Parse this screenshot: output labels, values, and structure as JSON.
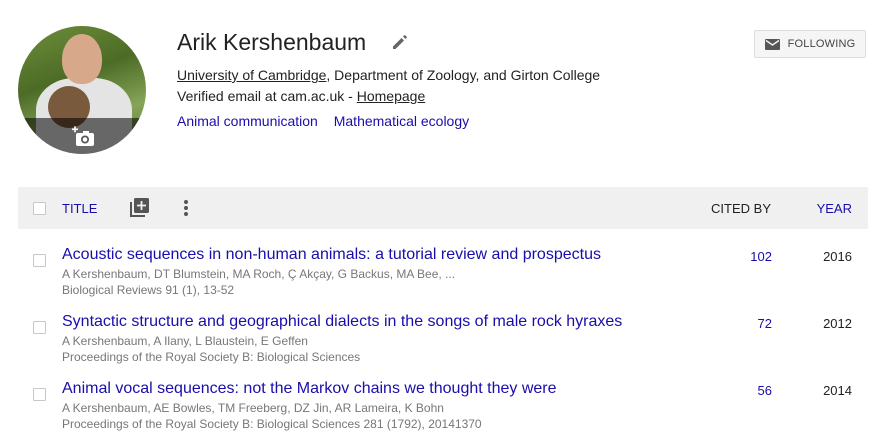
{
  "profile": {
    "name": "Arik Kershenbaum",
    "affiliation_link": "University of Cambridge",
    "affiliation_rest": ", Department of Zoology, and Girton College",
    "email_text": "Verified email at cam.ac.uk - ",
    "homepage_link": "Homepage",
    "interests": [
      "Animal communication",
      "Mathematical ecology"
    ],
    "follow_label": "FOLLOWING"
  },
  "table": {
    "title_label": "TITLE",
    "cited_label": "CITED BY",
    "year_label": "YEAR"
  },
  "articles": [
    {
      "title": "Acoustic sequences in non-human animals: a tutorial review and prospectus",
      "authors": "A Kershenbaum, DT Blumstein, MA Roch, Ç Akçay, G Backus, MA Bee, ...",
      "venue": "Biological Reviews 91 (1), 13-52",
      "cited": "102",
      "year": "2016"
    },
    {
      "title": "Syntactic structure and geographical dialects in the songs of male rock hyraxes",
      "authors": "A Kershenbaum, A Ilany, L Blaustein, E Geffen",
      "venue": "Proceedings of the Royal Society B: Biological Sciences",
      "cited": "72",
      "year": "2012"
    },
    {
      "title": "Animal vocal sequences: not the Markov chains we thought they were",
      "authors": "A Kershenbaum, AE Bowles, TM Freeberg, DZ Jin, AR Lameira, K Bohn",
      "venue": "Proceedings of the Royal Society B: Biological Sciences 281 (1792), 20141370",
      "cited": "56",
      "year": "2014"
    }
  ],
  "colors": {
    "link": "#1a0dab",
    "muted": "#777777",
    "header_bg": "#f0f0f0"
  },
  "icons": [
    "camera-add-icon",
    "edit-pencil-icon",
    "mail-icon",
    "add-to-library-icon",
    "more-vert-icon"
  ]
}
